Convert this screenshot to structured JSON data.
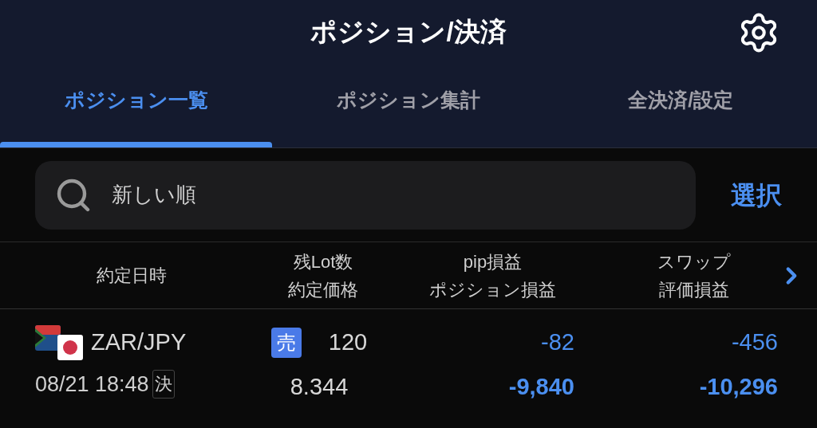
{
  "header": {
    "title": "ポジション/決済"
  },
  "tabs": [
    {
      "label": "ポジション一覧",
      "selected": true
    },
    {
      "label": "ポジション集計",
      "selected": false
    },
    {
      "label": "全決済/設定",
      "selected": false
    }
  ],
  "search": {
    "value": "新しい順"
  },
  "select_button": "選択",
  "columns": [
    {
      "lines": [
        "約定日時"
      ]
    },
    {
      "lines": [
        "残Lot数",
        "約定価格"
      ]
    },
    {
      "lines": [
        "pip損益",
        "ポジション損益"
      ]
    },
    {
      "lines": [
        "スワップ",
        "評価損益"
      ]
    }
  ],
  "rows": [
    {
      "pair": "ZAR/JPY",
      "datetime": "08/21 18:48",
      "settle_mark": "決",
      "side": "売",
      "lots": "120",
      "price": "8.344",
      "pip_pl": "-82",
      "position_pl": "-9,840",
      "swap": "-456",
      "valuation_pl": "-10,296"
    }
  ]
}
